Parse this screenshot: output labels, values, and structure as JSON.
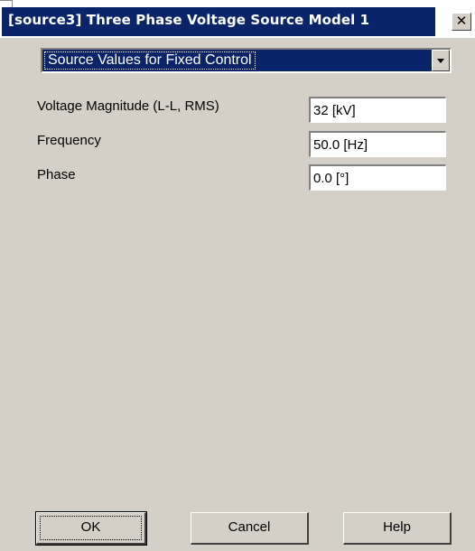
{
  "window": {
    "title": "[source3] Three Phase Voltage Source Model 1",
    "close_glyph": "✕"
  },
  "category_select": {
    "selected": "Source Values for Fixed Control"
  },
  "parameters": [
    {
      "label": "Voltage Magnitude (L-L, RMS)",
      "value": "32 [kV]"
    },
    {
      "label": "Frequency",
      "value": "50.0 [Hz]"
    },
    {
      "label": "Phase",
      "value": "0.0 [°]"
    }
  ],
  "buttons": {
    "ok": "OK",
    "cancel": "Cancel",
    "help": "Help"
  },
  "colors": {
    "title_bar": "#0a246a",
    "dialog_face": "#d4d0c8",
    "selection": "#0a246a"
  },
  "icons": {
    "close": "close-icon",
    "dropdown": "chevron-down-icon"
  }
}
